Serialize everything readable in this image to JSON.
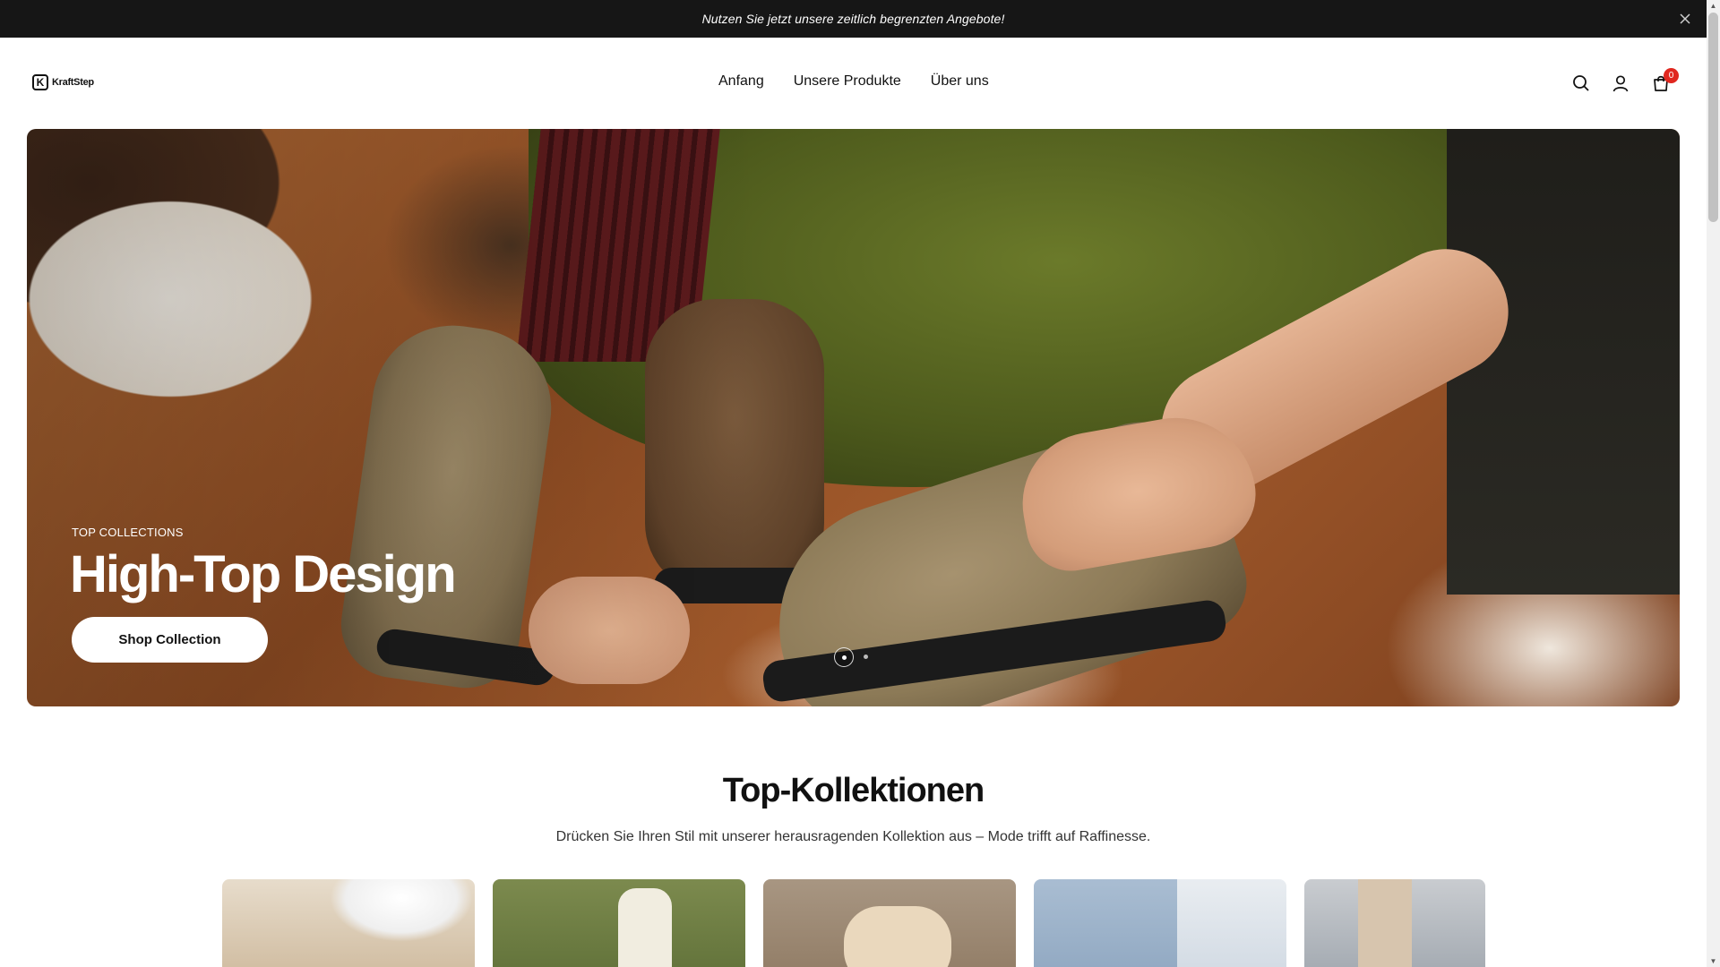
{
  "announcement": {
    "text": "Nutzen Sie jetzt unsere zeitlich begrenzten Angebote!",
    "close_icon": "close-icon"
  },
  "header": {
    "logo": {
      "mark": "K",
      "word": "KraftStep"
    },
    "nav": [
      "Anfang",
      "Unsere Produkte",
      "Über uns"
    ],
    "icons": [
      "search-icon",
      "user-icon",
      "cart-icon"
    ],
    "cart_count": "0"
  },
  "hero": {
    "eyebrow": "TOP COLLECTIONS",
    "title": "High-Top Design",
    "button_label": "Shop Collection",
    "slide_count": 2,
    "active_slide": 1
  },
  "collections": {
    "title": "Top-Kollektionen",
    "subtitle": "Drücken Sie Ihren Stil mit unserer herausragenden Kollektion aus – Mode trifft auf Raffinesse."
  },
  "colors": {
    "announcement_bg": "#161616",
    "badge": "#e0271f",
    "text": "#111111"
  }
}
